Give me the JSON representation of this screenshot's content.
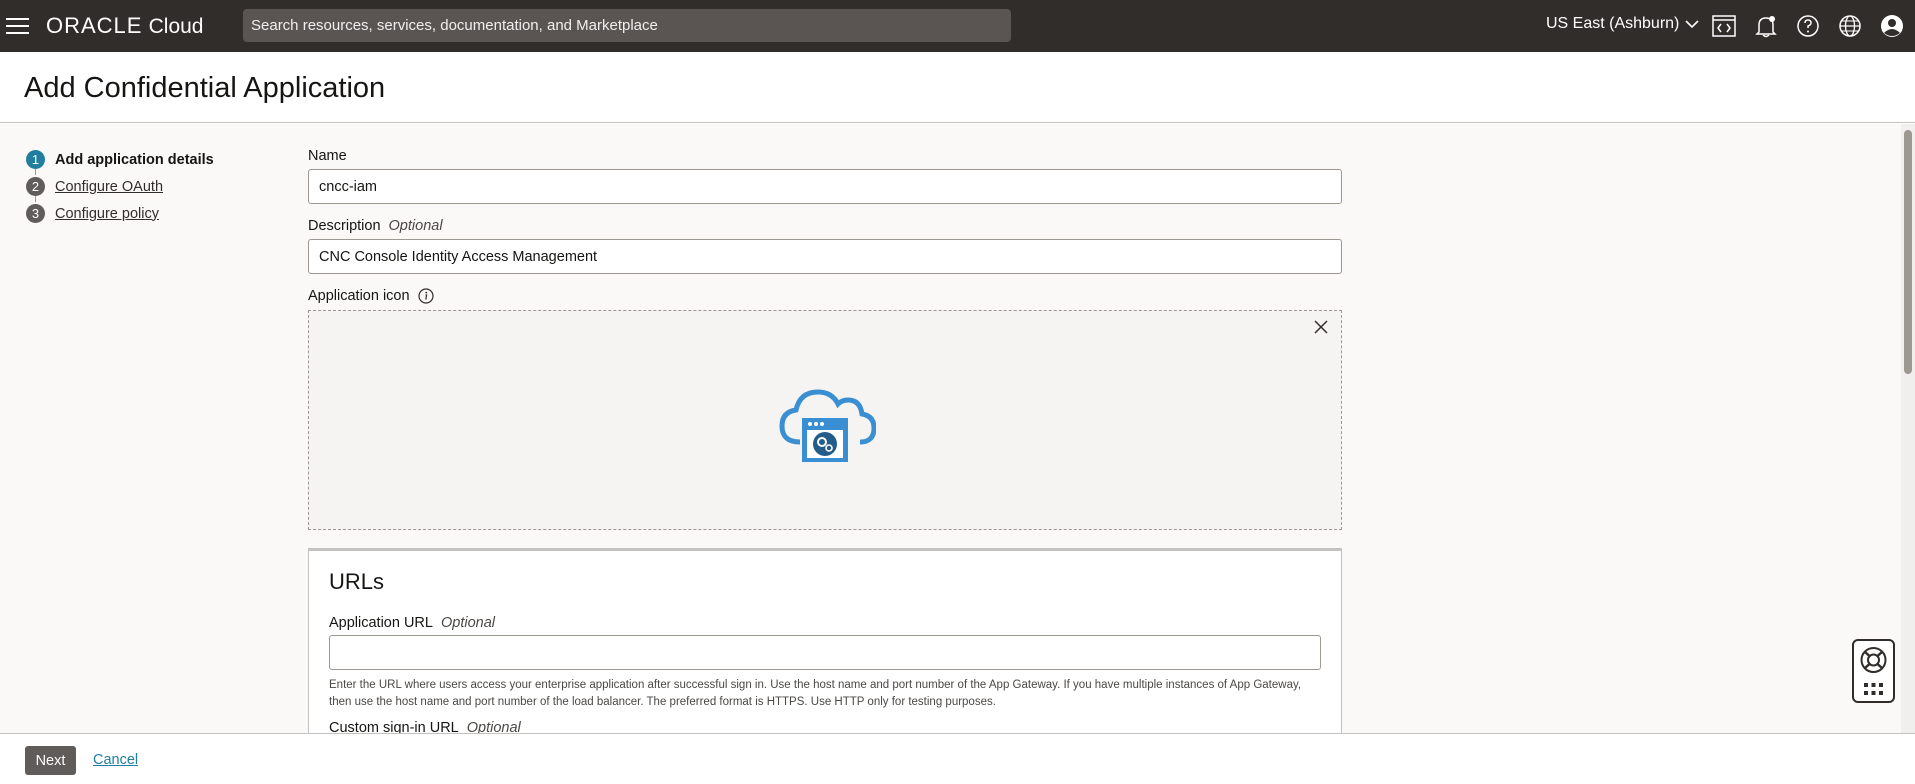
{
  "topbar": {
    "brand": "ORACLE",
    "product": "Cloud",
    "search_placeholder": "Search resources, services, documentation, and Marketplace",
    "region": "US East (Ashburn)"
  },
  "header": {
    "title": "Add Confidential Application"
  },
  "steps": [
    {
      "number": "1",
      "label": "Add application details"
    },
    {
      "number": "2",
      "label": "Configure OAuth"
    },
    {
      "number": "3",
      "label": "Configure policy"
    }
  ],
  "form": {
    "name_label": "Name",
    "name_value": "cncc-iam",
    "description_label": "Description",
    "description_optional": "Optional",
    "description_value": "CNC Console Identity Access Management",
    "icon_label": "Application icon"
  },
  "urls": {
    "title": "URLs",
    "app_url_label": "Application URL",
    "app_url_optional": "Optional",
    "app_url_value": "",
    "app_url_hint": "Enter the URL where users access your enterprise application after successful sign in. Use the host name and port number of the App Gateway. If you have multiple instances of App Gateway, then use the host name and port number of the load balancer. The preferred format is HTTPS. Use HTTP only for testing purposes.",
    "custom_signin_label": "Custom sign-in URL",
    "custom_signin_optional": "Optional"
  },
  "footer": {
    "next_label": "Next",
    "cancel_label": "Cancel"
  },
  "colors": {
    "topbar_bg": "#312d2a",
    "accent": "#227e9e",
    "icon_blue": "#3a8fd3"
  }
}
